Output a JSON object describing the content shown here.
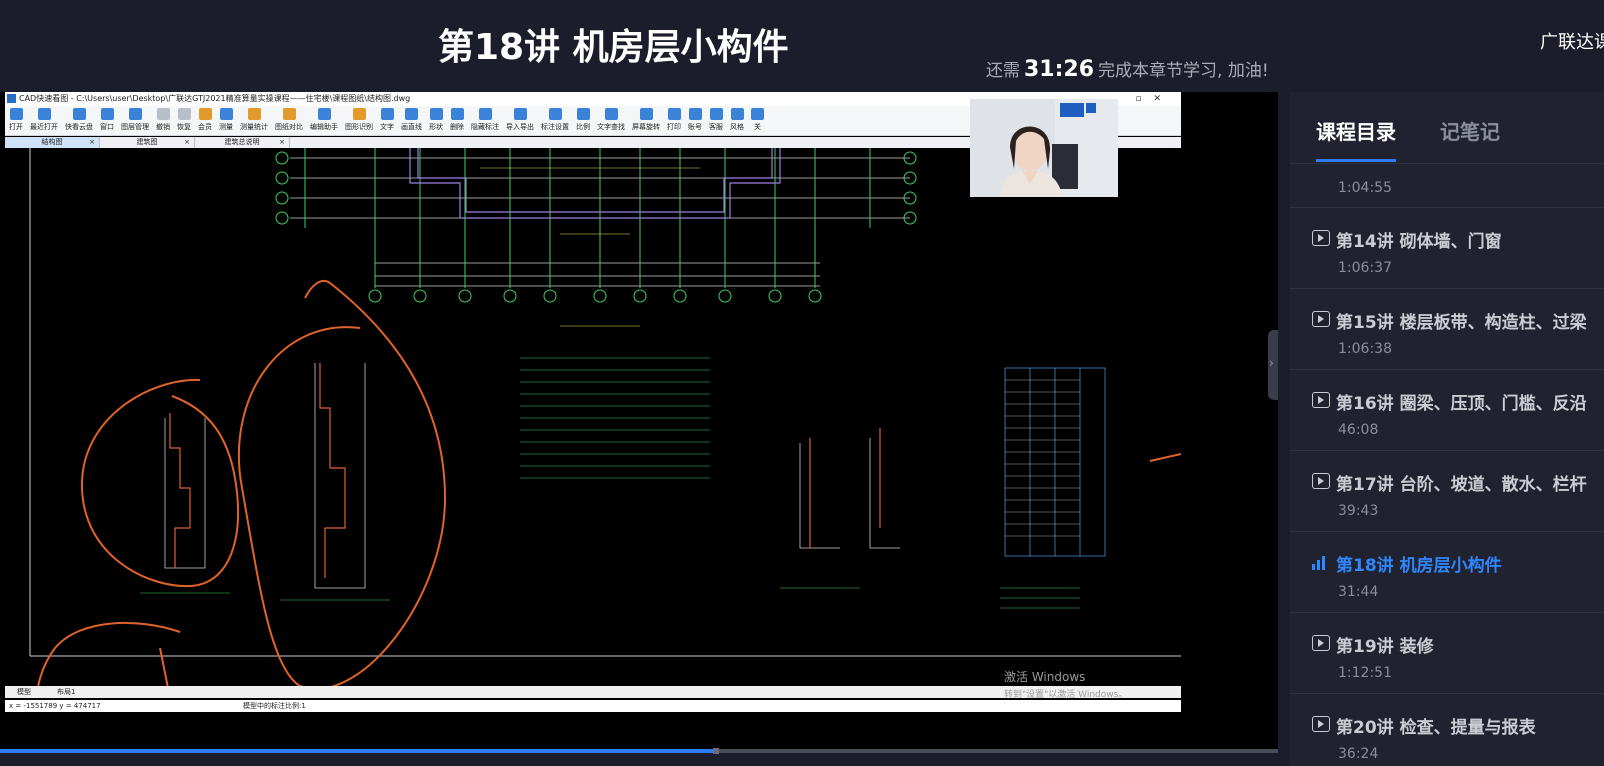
{
  "header": {
    "lesson_title": "第18讲 机房层小构件",
    "brand": "广联达课",
    "remain_prefix": "还需",
    "remain_time": "31:26",
    "remain_suffix": "完成本章节学习, 加油!"
  },
  "cad": {
    "window_title": "CAD快速看图 - C:\\Users\\user\\Desktop\\广联达GTJ2021精准算量实操课程——住宅楼\\课程图纸\\结构图.dwg",
    "toolbar": [
      "打开",
      "最近打开",
      "快看云盘",
      "窗口",
      "图层管理",
      "撤销",
      "恢复",
      "会员",
      "测量",
      "测量统计",
      "图纸对比",
      "编辑助手",
      "图形识别",
      "文字",
      "画直线",
      "形状",
      "删除",
      "隐藏标注",
      "导入导出",
      "标注设置",
      "比例",
      "文字查找",
      "屏幕旋转",
      "打印",
      "账号",
      "客服",
      "风格",
      "关"
    ],
    "tabs": [
      "结构图",
      "建筑图",
      "建筑总说明"
    ],
    "bottom_tabs": [
      "模型",
      "布局1"
    ],
    "status_coords": "x = -1551789  y = 474717",
    "status_scale": "模型中的标注比例:1",
    "watermark_line1": "激活 Windows",
    "watermark_line2": "转到\"设置\"以激活 Windows。"
  },
  "sidebar": {
    "tab_catalog": "课程目录",
    "tab_notes": "记笔记",
    "lessons": [
      {
        "title": "",
        "duration": "1:04:55",
        "state": "partial"
      },
      {
        "title": "第14讲 砌体墙、门窗",
        "duration": "1:06:37",
        "state": "normal"
      },
      {
        "title": "第15讲 楼层板带、构造柱、过梁",
        "duration": "1:06:38",
        "state": "normal"
      },
      {
        "title": "第16讲 圈梁、压顶、门槛、反沿",
        "duration": "46:08",
        "state": "normal"
      },
      {
        "title": "第17讲 台阶、坡道、散水、栏杆",
        "duration": "39:43",
        "state": "normal"
      },
      {
        "title": "第18讲 机房层小构件",
        "duration": "31:44",
        "state": "active"
      },
      {
        "title": "第19讲 装修",
        "duration": "1:12:51",
        "state": "normal"
      },
      {
        "title": "第20讲 检查、提量与报表",
        "duration": "36:24",
        "state": "normal"
      }
    ]
  },
  "player": {
    "progress": 0.56
  },
  "colors": {
    "accent": "#2f7df6",
    "background": "#1b1e2a",
    "sidebar": "#20232f",
    "annotation": "#e0642a"
  }
}
